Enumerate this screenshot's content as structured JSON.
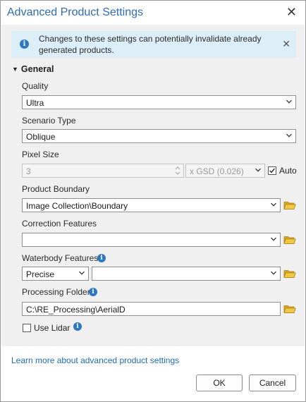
{
  "dialog": {
    "title": "Advanced Product Settings"
  },
  "banner": {
    "text": "Changes to these settings can potentially invalidate already generated products."
  },
  "section": {
    "label": "General"
  },
  "quality": {
    "label": "Quality",
    "value": "Ultra"
  },
  "scenario": {
    "label": "Scenario Type",
    "value": "Oblique"
  },
  "pixel": {
    "label": "Pixel Size",
    "value": "3",
    "unit": "x GSD (0.026)",
    "auto_label": "Auto",
    "auto_checked": true
  },
  "boundary": {
    "label": "Product Boundary",
    "value": "Image Collection\\Boundary"
  },
  "correction": {
    "label": "Correction Features",
    "value": ""
  },
  "waterbody": {
    "label": "Waterbody Features",
    "mode": "Precise",
    "value": ""
  },
  "processing": {
    "label": "Processing Folder",
    "value": "C:\\RE_Processing\\AerialD"
  },
  "lidar": {
    "label": "Use Lidar",
    "checked": false
  },
  "footer": {
    "link": "Learn more about advanced product settings",
    "ok": "OK",
    "cancel": "Cancel"
  },
  "colors": {
    "accent": "#2d6cb5",
    "banner": "#dceef8",
    "panel": "#f0f0f0",
    "folder": "#e6b530"
  }
}
